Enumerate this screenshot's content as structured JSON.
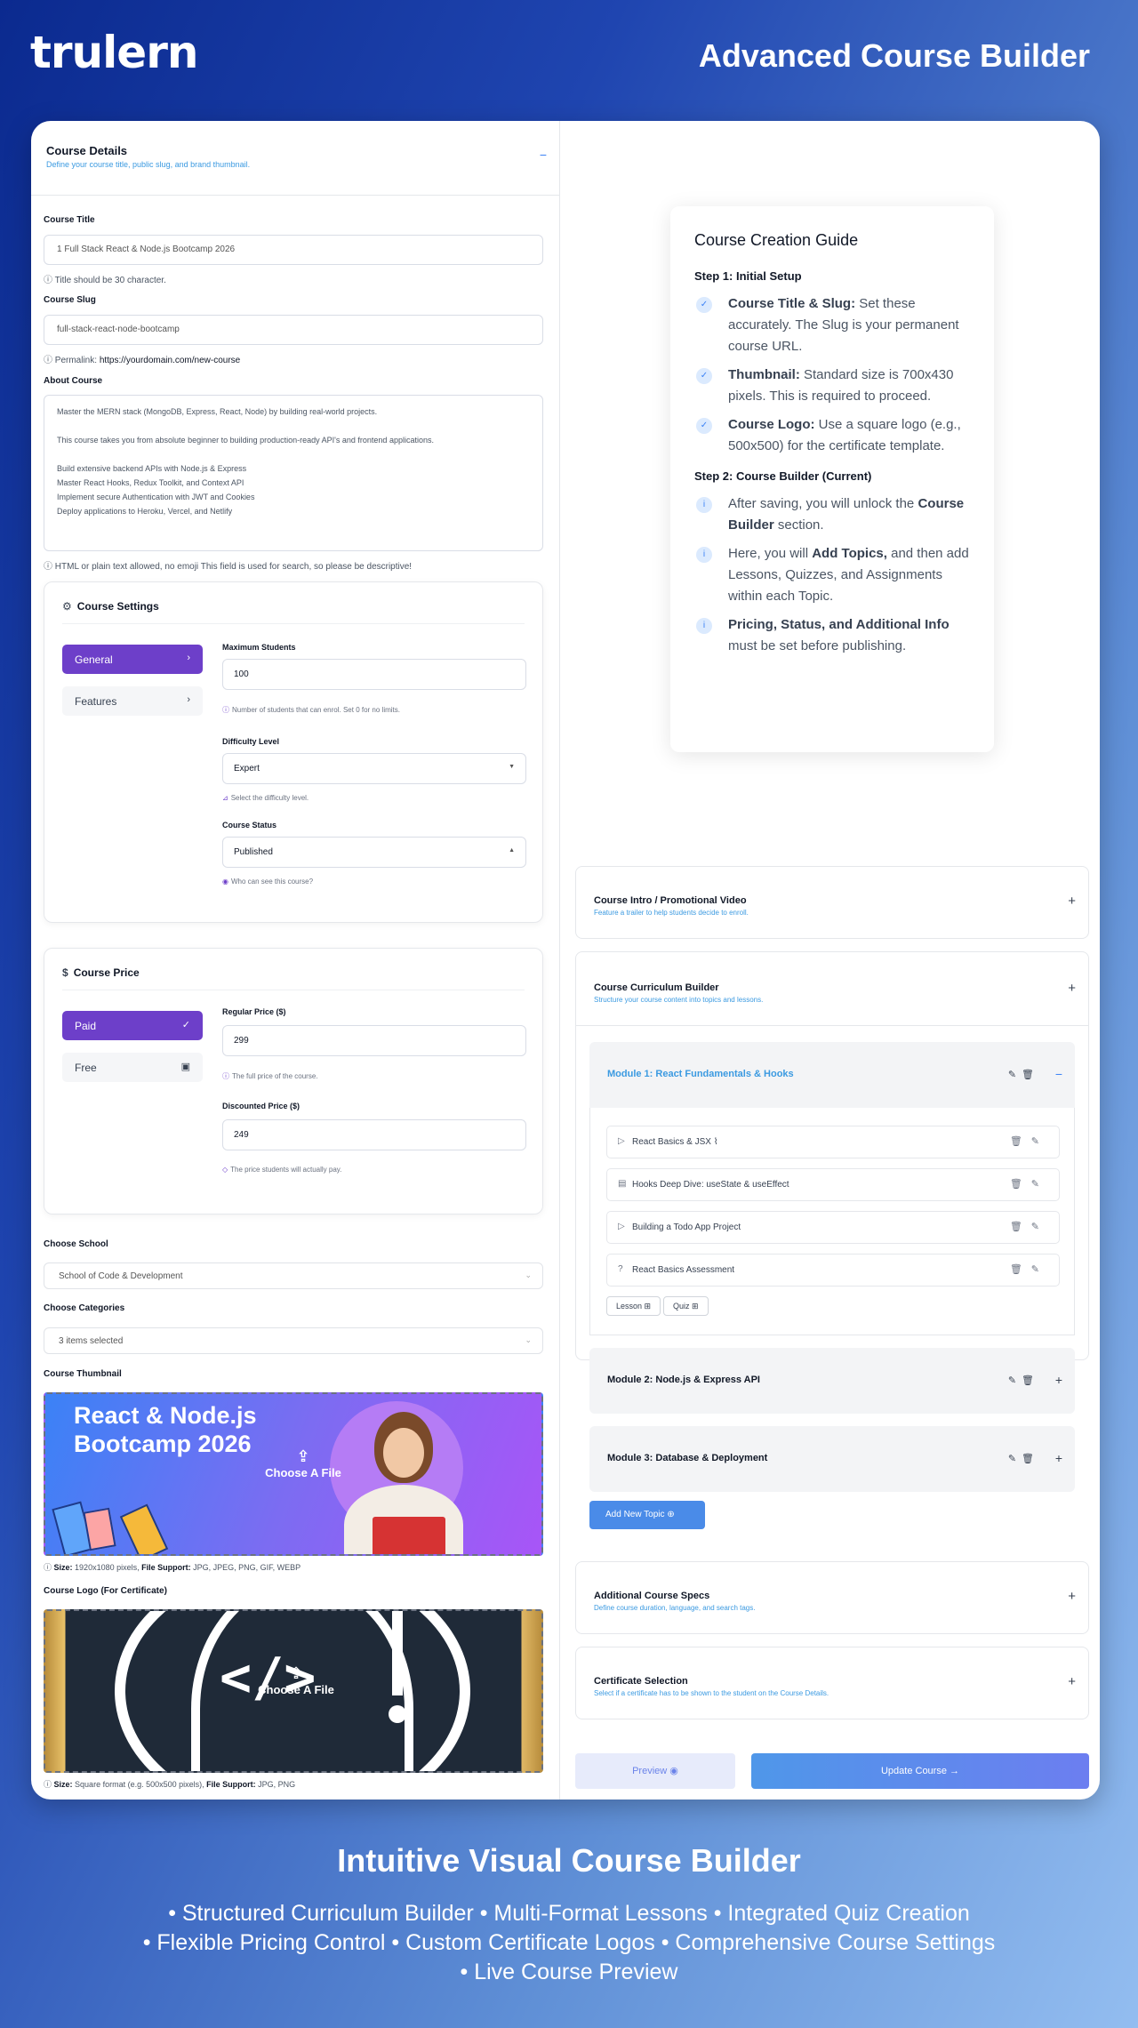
{
  "brand": {
    "logo": "trulern",
    "hero_title": "Advanced Course Builder"
  },
  "course_details": {
    "title": "Course Details",
    "subtitle": "Define your course title, public slug, and brand thumbnail.",
    "toggle": "−",
    "course_title_label": "Course Title",
    "course_title_value": "1 Full Stack React & Node.js Bootcamp 2026",
    "course_title_hint": "Title should be 30 character.",
    "slug_label": "Course Slug",
    "slug_value": "full-stack-react-node-bootcamp",
    "permalink_label": "Permalink:",
    "permalink_value": "https://yourdomain.com/new-course",
    "about_label": "About Course",
    "about_lines": [
      "Master the MERN stack (MongoDB, Express, React, Node) by building real-world projects.",
      "",
      "This course takes you from absolute beginner to building production-ready API's and frontend applications.",
      "",
      "Build extensive backend APIs with Node.js & Express",
      "Master React Hooks, Redux Toolkit, and Context API",
      "Implement secure Authentication with JWT and Cookies",
      "Deploy applications to Heroku, Vercel, and Netlify"
    ],
    "about_hint": "HTML or plain text allowed, no emoji This field is used for search, so please be descriptive!"
  },
  "course_settings": {
    "title": "Course Settings",
    "tabs": [
      {
        "label": "General",
        "active": true
      },
      {
        "label": "Features",
        "active": false
      }
    ],
    "max_students_label": "Maximum Students",
    "max_students_value": "100",
    "max_students_hint": "Number of students that can enrol. Set 0 for no limits.",
    "difficulty_label": "Difficulty Level",
    "difficulty_value": "Expert",
    "difficulty_hint": "Select the difficulty level.",
    "status_label": "Course Status",
    "status_value": "Published",
    "status_hint": "Who can see this course?"
  },
  "course_price": {
    "title": "Course Price",
    "tabs": [
      {
        "label": "Paid",
        "active": true
      },
      {
        "label": "Free",
        "active": false
      }
    ],
    "regular_label": "Regular Price ($)",
    "regular_value": "299",
    "regular_hint": "The full price of the course.",
    "discount_label": "Discounted Price ($)",
    "discount_value": "249",
    "discount_hint": "The price students will actually pay."
  },
  "school": {
    "label": "Choose School",
    "value": "School of Code & Development"
  },
  "categories": {
    "label": "Choose Categories",
    "value": "3 items selected"
  },
  "thumbnail": {
    "label": "Course Thumbnail",
    "image_text": "React & Node.js Bootcamp 2026",
    "cta": "Choose A File",
    "size_label": "Size:",
    "size_value": "1920x1080 pixels,",
    "support_label": "File Support:",
    "support_value": "JPG, JPEG, PNG, GIF, WEBP"
  },
  "logo_upload": {
    "label": "Course Logo (For Certificate)",
    "cta": "Choose A File",
    "size_label": "Size:",
    "size_value": "Square format (e.g. 500x500 pixels),",
    "support_label": "File Support:",
    "support_value": "JPG, PNG"
  },
  "guide": {
    "title": "Course Creation Guide",
    "step1": "Step 1: Initial Setup",
    "step1_items": [
      {
        "bold": "Course Title & Slug:",
        "text": "Set these accurately. The Slug is your permanent course URL."
      },
      {
        "bold": "Thumbnail:",
        "text": "Standard size is 700x430 pixels. This is required to proceed."
      },
      {
        "bold": "Course Logo:",
        "text": "Use a square logo (e.g., 500x500) for the certificate template."
      }
    ],
    "step2": "Step 2: Course Builder (Current)",
    "step2_items": [
      {
        "pre": "After saving, you will unlock the",
        "bold": "Course Builder",
        "post": "section."
      },
      {
        "pre": "Here, you will",
        "bold": "Add Topics,",
        "post": "and then add Lessons, Quizzes, and Assignments within each Topic."
      },
      {
        "pre": "",
        "bold": "Pricing, Status, and Additional Info",
        "post": "must be set before publishing."
      }
    ]
  },
  "intro_video": {
    "title": "Course Intro / Promotional Video",
    "subtitle": "Feature a trailer to help students decide to enroll."
  },
  "curriculum": {
    "title": "Course Curriculum Builder",
    "subtitle": "Structure your course content into topics and lessons.",
    "modules": [
      {
        "title": "Module 1: React Fundamentals & Hooks",
        "expanded": true
      },
      {
        "title": "Module 2: Node.js & Express API",
        "expanded": false
      },
      {
        "title": "Module 3: Database & Deployment",
        "expanded": false
      }
    ],
    "lessons": [
      {
        "icon": "play-icon",
        "title": "React Basics & JSX"
      },
      {
        "icon": "document-icon",
        "title": "Hooks Deep Dive: useState & useEffect"
      },
      {
        "icon": "play-icon",
        "title": "Building a Todo App Project"
      },
      {
        "icon": "quiz-icon",
        "title": "React Basics Assessment"
      }
    ],
    "lesson_btn": "Lesson",
    "quiz_btn": "Quiz",
    "add_topic": "Add New Topic"
  },
  "additional_specs": {
    "title": "Additional Course Specs",
    "subtitle": "Define course duration, language, and search tags."
  },
  "certificate": {
    "title": "Certificate Selection",
    "subtitle": "Select if a certificate has to be shown to the student on the Course Details."
  },
  "actions": {
    "preview": "Preview",
    "update": "Update Course"
  },
  "footer": {
    "title": "Intuitive Visual Course Builder",
    "lines": [
      "• Structured Curriculum Builder • Multi-Format Lessons • Integrated Quiz Creation",
      "• Flexible Pricing Control • Custom Certificate Logos • Comprehensive Course Settings",
      "• Live Course Preview"
    ]
  },
  "colors": {
    "accent_purple": "#6d3fc9",
    "accent_blue": "#3b9ae1",
    "button_blue": "#4a8be8"
  }
}
